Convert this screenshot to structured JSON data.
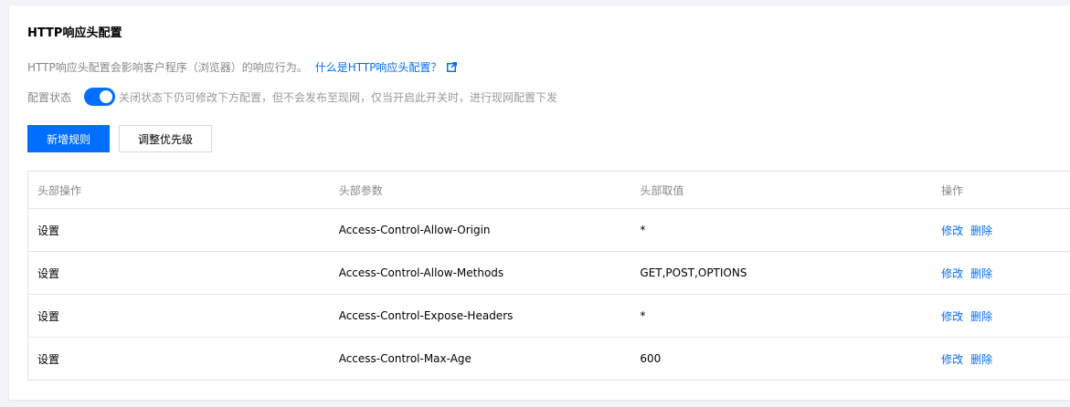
{
  "section": {
    "title": "HTTP响应头配置",
    "description": "HTTP响应头配置会影响客户程序（浏览器）的响应行为。",
    "help_link": "什么是HTTP响应头配置？",
    "status_label": "配置状态",
    "status_on": true,
    "status_hint": "关闭状态下仍可修改下方配置，但不会发布至现网，仅当开启此开关时，进行现网配置下发"
  },
  "toolbar": {
    "add_label": "新增规则",
    "priority_label": "调整优先级"
  },
  "table": {
    "headers": [
      "头部操作",
      "头部参数",
      "头部取值",
      "操作"
    ],
    "rows": [
      {
        "action": "设置",
        "param": "Access-Control-Allow-Origin",
        "value": "*",
        "edit": "修改",
        "delete": "删除"
      },
      {
        "action": "设置",
        "param": "Access-Control-Allow-Methods",
        "value": "GET,POST,OPTIONS",
        "edit": "修改",
        "delete": "删除"
      },
      {
        "action": "设置",
        "param": "Access-Control-Expose-Headers",
        "value": "*",
        "edit": "修改",
        "delete": "删除"
      },
      {
        "action": "设置",
        "param": "Access-Control-Max-Age",
        "value": "600",
        "edit": "修改",
        "delete": "删除"
      }
    ]
  },
  "colors": {
    "accent": "#006eff",
    "muted": "#888888"
  },
  "icons": {
    "external_link": "external-link-icon"
  }
}
